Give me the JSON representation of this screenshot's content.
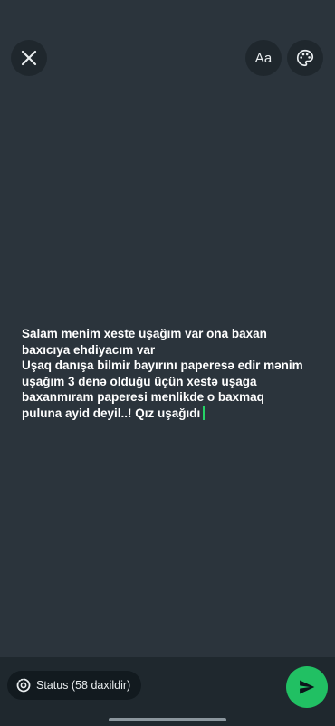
{
  "top_bar": {
    "close_icon": "close-icon",
    "font_button_label": "Aa",
    "palette_icon": "palette-icon"
  },
  "status_text": {
    "lines": [
      "Salam menim xeste uşağım var ona baxan",
      "baxıcıya ehdiyacım var",
      "Uşaq danışa bilmir bayırını paperesə edir mənim",
      "uşağım 3 denə olduğu üçün xestə uşaga",
      "baxanmıram paperesi menlikde o baxmaq",
      "puluna ayid deyil..! Qız uşağıdı"
    ]
  },
  "bottom_bar": {
    "audience_label": "Status (58 daxildir)",
    "audience_icon": "status-ring-icon",
    "send_icon": "send-icon"
  },
  "colors": {
    "background": "#2b343c",
    "accent": "#21c063",
    "cursor": "#25d366"
  }
}
